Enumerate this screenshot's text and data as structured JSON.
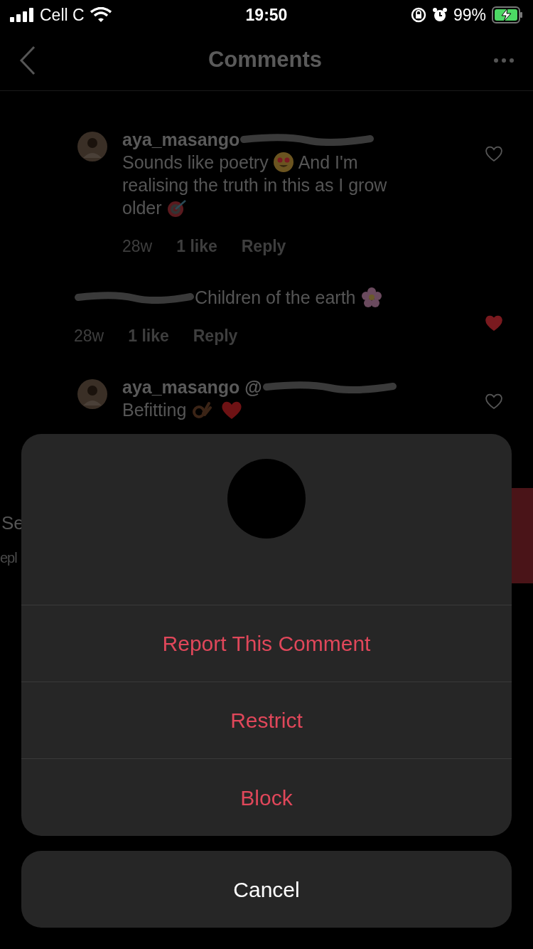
{
  "status_bar": {
    "carrier": "Cell C",
    "time": "19:50",
    "battery": "99%"
  },
  "header": {
    "title": "Comments"
  },
  "comments": [
    {
      "username": "aya_masango",
      "lines": [
        [
          {
            "kind": "text",
            "text": "Sounds like poetry"
          },
          {
            "kind": "heart-eyes"
          },
          {
            "kind": "text",
            "text": "And I'm"
          }
        ],
        [
          {
            "kind": "text",
            "text": "realising the truth in this as I grow"
          }
        ],
        [
          {
            "kind": "text",
            "text": "older"
          },
          {
            "kind": "target"
          }
        ]
      ],
      "time": "28w",
      "likes": "1 like",
      "reply": "Reply",
      "liked": false
    },
    {
      "lines": [
        [
          {
            "kind": "text",
            "text": "Children of the earth"
          },
          {
            "kind": "flower"
          }
        ]
      ],
      "time": "28w",
      "likes": "1 like",
      "reply": "Reply",
      "liked": true
    },
    {
      "username": "aya_masango @",
      "lines": [
        [
          {
            "kind": "text",
            "text": "Befitting"
          },
          {
            "kind": "ok-hand"
          },
          {
            "kind": "heart"
          }
        ]
      ],
      "liked": false
    }
  ],
  "partial_row": {
    "text": "Se",
    "subtext": "epl"
  },
  "sheet": {
    "actions": [
      "Report This Comment",
      "Restrict",
      "Block"
    ],
    "cancel": "Cancel"
  }
}
